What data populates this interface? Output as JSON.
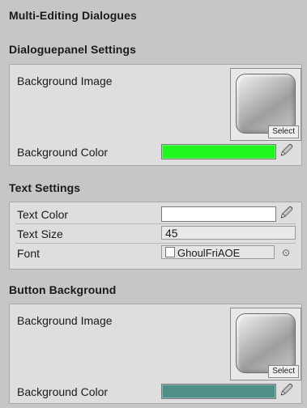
{
  "title": "Multi-Editing Dialogues",
  "dialogue_panel": {
    "header": "Dialoguepanel Settings",
    "background_image_label": "Background Image",
    "select_label": "Select",
    "background_color_label": "Background Color",
    "background_color": "#1ff51f"
  },
  "text_settings": {
    "header": "Text Settings",
    "text_color_label": "Text Color",
    "text_color": "#ffffff",
    "text_size_label": "Text Size",
    "text_size_value": "45",
    "font_label": "Font",
    "font_value": "GhoulFriAOE"
  },
  "button_background": {
    "header": "Button Background",
    "background_image_label": "Background Image",
    "select_label": "Select",
    "background_color_label": "Background Color",
    "background_color": "#4e8f87"
  },
  "icons": {
    "eyedropper": "eyedropper-icon",
    "object_picker": "object-picker-icon",
    "font_file": "font-file-icon"
  }
}
